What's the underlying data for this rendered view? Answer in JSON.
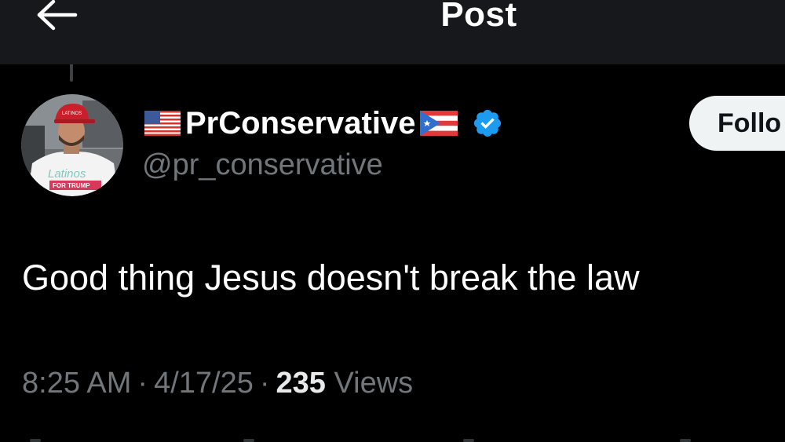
{
  "header": {
    "title": "Post"
  },
  "post": {
    "display_name": "PrConservative",
    "handle": "@pr_conservative",
    "follow_label": "Follo",
    "text": "Good thing Jesus doesn't break the law",
    "time": "8:25 AM",
    "separator": "·",
    "date": "4/17/25",
    "views_count": "235",
    "views_label": "Views"
  },
  "avatar": {
    "hat_text": "LATINOS",
    "shirt_text": "Latinos",
    "banner_text": "FOR TRUMP"
  },
  "colors": {
    "background": "#000000",
    "header": "#16181c",
    "secondary_text": "#71767b",
    "verified_blue": "#1d9bf0",
    "follow_bg": "#eff3f4"
  },
  "icons": [
    "back-arrow-icon",
    "us-flag-icon",
    "puerto-rico-flag-icon",
    "verified-badge-icon"
  ]
}
